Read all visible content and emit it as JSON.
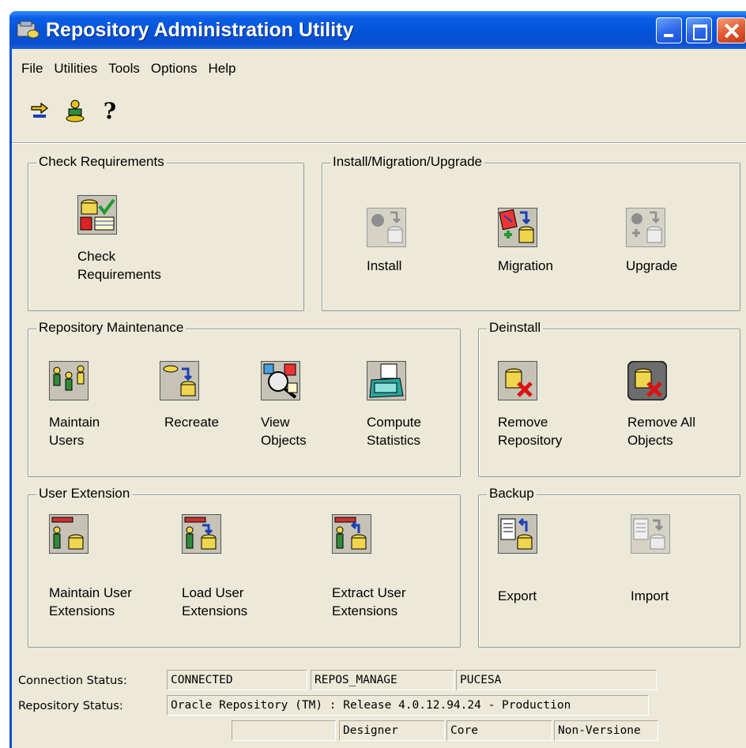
{
  "window": {
    "title": "Repository Administration Utility"
  },
  "menu": [
    "File",
    "Utilities",
    "Tools",
    "Options",
    "Help"
  ],
  "toolbar": {
    "help_glyph": "?",
    "icons": [
      "connect-icon",
      "add-user-icon",
      "help-icon"
    ]
  },
  "groups": {
    "check": {
      "title": "Check Requirements",
      "items": [
        {
          "label": "Check\nRequirements",
          "icon": "check-requirements-icon",
          "enabled": true
        }
      ]
    },
    "install": {
      "title": "Install/Migration/Upgrade",
      "items": [
        {
          "label": "Install",
          "icon": "install-icon",
          "enabled": false
        },
        {
          "label": "Migration",
          "icon": "migration-icon",
          "enabled": true
        },
        {
          "label": "Upgrade",
          "icon": "upgrade-icon",
          "enabled": false
        }
      ]
    },
    "maintenance": {
      "title": "Repository Maintenance",
      "items": [
        {
          "label": "Maintain\nUsers",
          "icon": "maintain-users-icon",
          "enabled": true
        },
        {
          "label": "Recreate",
          "icon": "recreate-icon",
          "enabled": true
        },
        {
          "label": "View\nObjects",
          "icon": "view-objects-icon",
          "enabled": true
        },
        {
          "label": "Compute\nStatistics",
          "icon": "compute-statistics-icon",
          "enabled": true
        }
      ]
    },
    "deinstall": {
      "title": "Deinstall",
      "items": [
        {
          "label": "Remove\nRepository",
          "icon": "remove-repository-icon",
          "enabled": true
        },
        {
          "label": "Remove All\nObjects",
          "icon": "remove-all-objects-icon",
          "enabled": true
        }
      ]
    },
    "extension": {
      "title": "User Extension",
      "items": [
        {
          "label": "Maintain User\nExtensions",
          "icon": "maintain-user-extensions-icon",
          "enabled": true
        },
        {
          "label": "Load User\nExtensions",
          "icon": "load-user-extensions-icon",
          "enabled": true
        },
        {
          "label": "Extract User\nExtensions",
          "icon": "extract-user-extensions-icon",
          "enabled": true
        }
      ]
    },
    "backup": {
      "title": "Backup",
      "items": [
        {
          "label": "Export",
          "icon": "export-icon",
          "enabled": true
        },
        {
          "label": "Import",
          "icon": "import-icon",
          "enabled": false
        }
      ]
    }
  },
  "status": {
    "connection_label": "Connection Status:",
    "connection_value": "CONNECTED",
    "connection_user": "REPOS_MANAGE",
    "connection_db": "PUCESA",
    "repository_label": "Repository Status:",
    "repository_value": "Oracle Repository (TM) : Release 4.0.12.94.24 - Production",
    "bottom_fields": [
      "",
      "Designer",
      "Core",
      "Non-Versione"
    ]
  },
  "colors": {
    "titlebar": "#0553d8",
    "window_bg": "#ece9d8",
    "group_border": "#919b9c"
  }
}
